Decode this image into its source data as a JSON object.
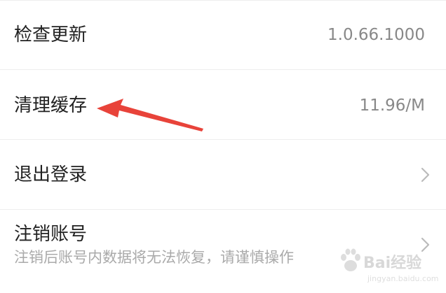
{
  "settings": {
    "rows": [
      {
        "label": "检查更新",
        "value": "1.0.66.1000"
      },
      {
        "label": "清理缓存",
        "value": "11.96/M"
      },
      {
        "label": "退出登录"
      },
      {
        "label": "注销账号",
        "subtitle": "注销后账号内数据将无法恢复，请谨慎操作"
      }
    ]
  },
  "icons": {
    "chevron": "chevron-right-icon",
    "annotation": "red-arrow-icon"
  },
  "colors": {
    "annotation_arrow": "#e8433a",
    "text": "#222222",
    "secondary": "#888888"
  },
  "watermark": {
    "brand": "Bai经验",
    "url": "jingyan.baidu.com"
  }
}
